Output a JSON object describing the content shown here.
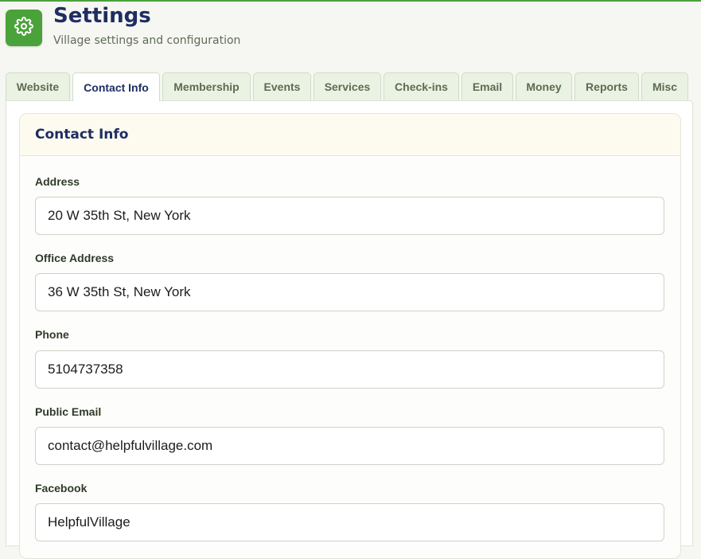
{
  "header": {
    "title": "Settings",
    "subtitle": "Village settings and configuration",
    "icon": "gear-icon",
    "icon_bg": "#4aa23a"
  },
  "tabs": [
    {
      "label": "Website",
      "active": false
    },
    {
      "label": "Contact Info",
      "active": true
    },
    {
      "label": "Membership",
      "active": false
    },
    {
      "label": "Events",
      "active": false
    },
    {
      "label": "Services",
      "active": false
    },
    {
      "label": "Check-ins",
      "active": false
    },
    {
      "label": "Email",
      "active": false
    },
    {
      "label": "Money",
      "active": false
    },
    {
      "label": "Reports",
      "active": false
    },
    {
      "label": "Misc",
      "active": false
    }
  ],
  "card": {
    "title": "Contact Info"
  },
  "fields": [
    {
      "label": "Address",
      "value": "20 W 35th St, New York"
    },
    {
      "label": "Office Address",
      "value": "36 W 35th St, New York"
    },
    {
      "label": "Phone",
      "value": "5104737358"
    },
    {
      "label": "Public Email",
      "value": "contact@helpfulvillage.com"
    },
    {
      "label": "Facebook",
      "value": "HelpfulVillage"
    }
  ],
  "colors": {
    "accent": "#4aa23a",
    "heading": "#1e2d63",
    "tab_bg": "#eaf3e3"
  }
}
